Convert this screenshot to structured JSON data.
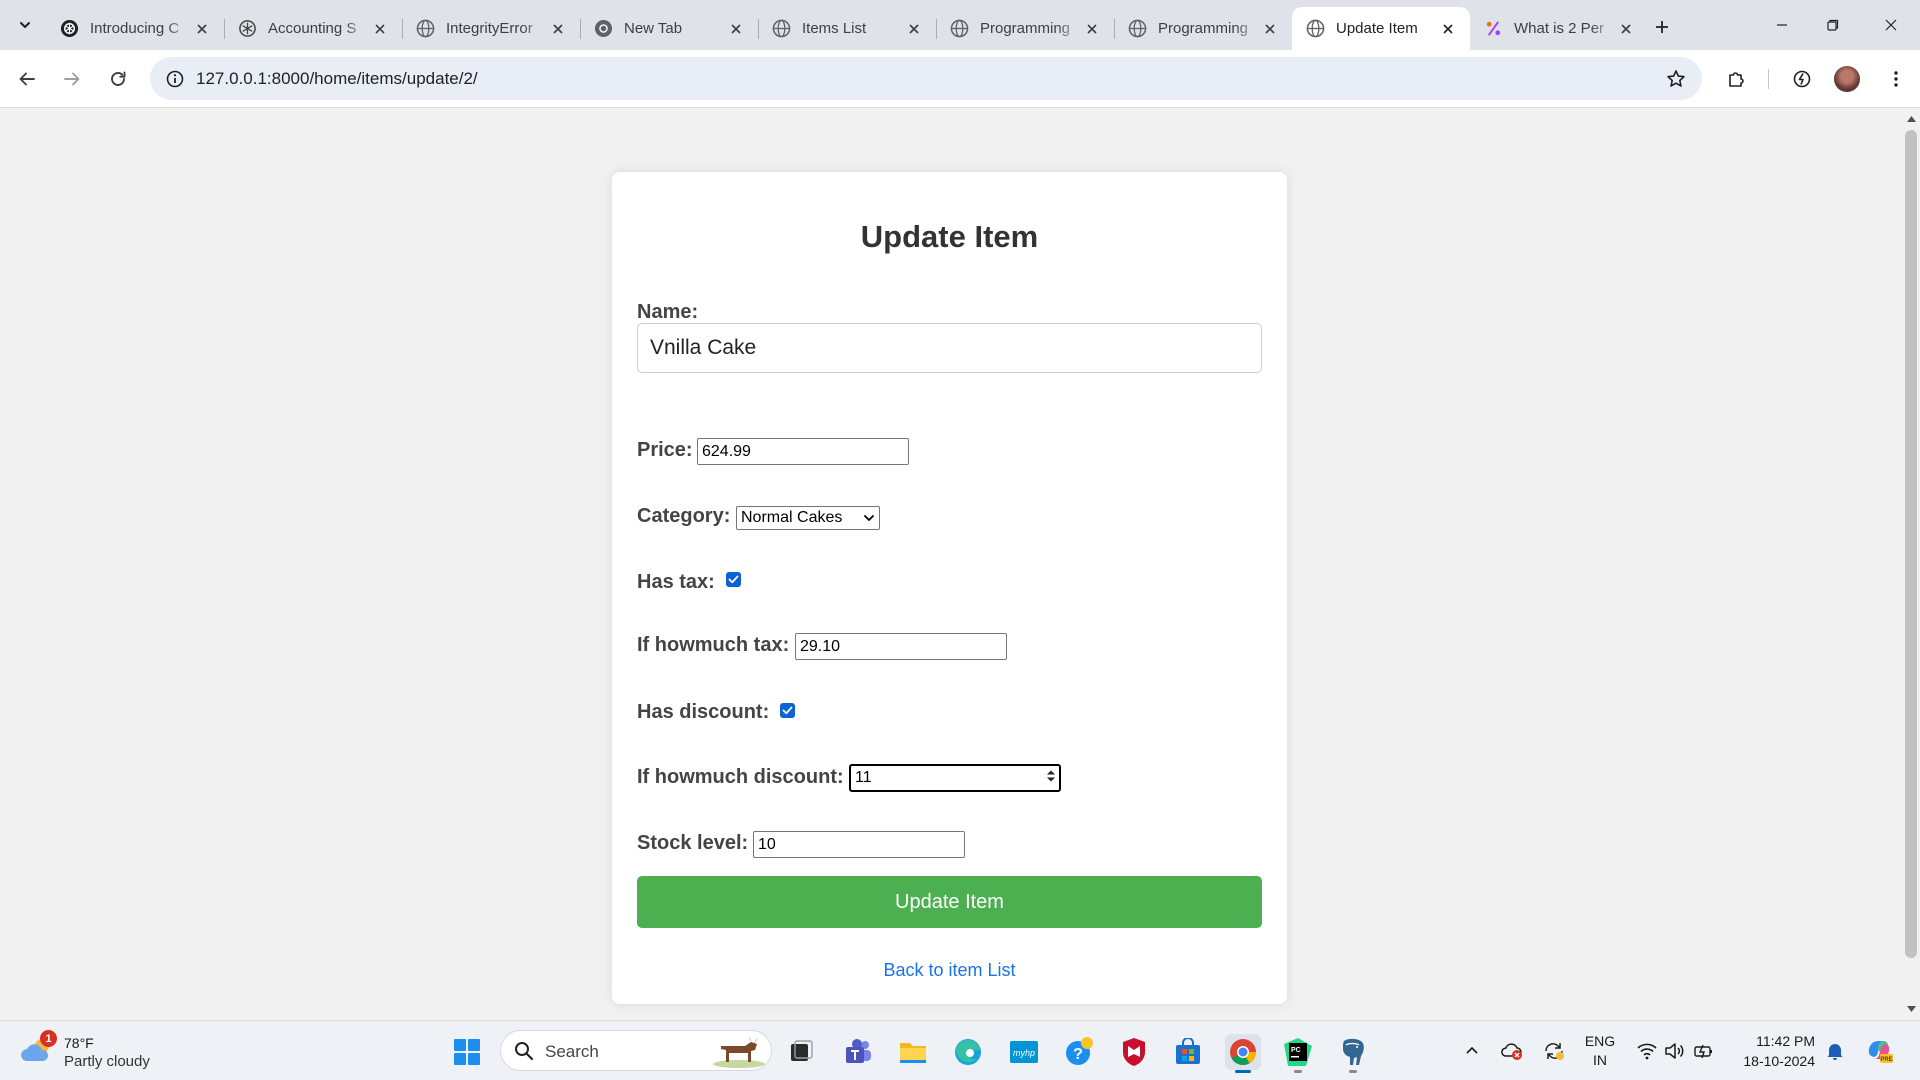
{
  "browser": {
    "tabs": [
      {
        "title": "Introducing C",
        "favicon": "chatgpt-icon"
      },
      {
        "title": "Accounting S",
        "favicon": "chatgpt-icon"
      },
      {
        "title": "IntegrityError",
        "favicon": "globe-icon"
      },
      {
        "title": "New Tab",
        "favicon": "chrome-icon"
      },
      {
        "title": "Items List",
        "favicon": "globe-icon"
      },
      {
        "title": "Programming",
        "favicon": "globe-icon"
      },
      {
        "title": "Programming",
        "favicon": "globe-icon"
      },
      {
        "title": "Update Item",
        "favicon": "globe-icon",
        "active": true
      },
      {
        "title": "What is 2 Per",
        "favicon": "percent-icon"
      }
    ],
    "url": "127.0.0.1:8000/home/items/update/2/"
  },
  "form": {
    "heading": "Update Item",
    "name_label": "Name:",
    "name_value": "Vnilla Cake",
    "price_label": "Price:",
    "price_value": "624.99",
    "category_label": "Category:",
    "category_value": "Normal Cakes",
    "has_tax_label": "Has tax:",
    "has_tax_checked": true,
    "tax_amount_label": "If howmuch tax:",
    "tax_amount_value": "29.10",
    "has_discount_label": "Has discount:",
    "has_discount_checked": true,
    "discount_amount_label": "If howmuch discount:",
    "discount_amount_value": "11",
    "stock_label": "Stock level:",
    "stock_value": "10",
    "submit_label": "Update Item",
    "back_link": "Back to item List",
    "accent_color": "#4caf50",
    "link_color": "#1a73e8"
  },
  "taskbar": {
    "weather_badge": "1",
    "weather_temp": "78°F",
    "weather_condition": "Partly cloudy",
    "search_placeholder": "Search",
    "lang_line1": "ENG",
    "lang_line2": "IN",
    "time": "11:42 PM",
    "date": "18-10-2024"
  }
}
